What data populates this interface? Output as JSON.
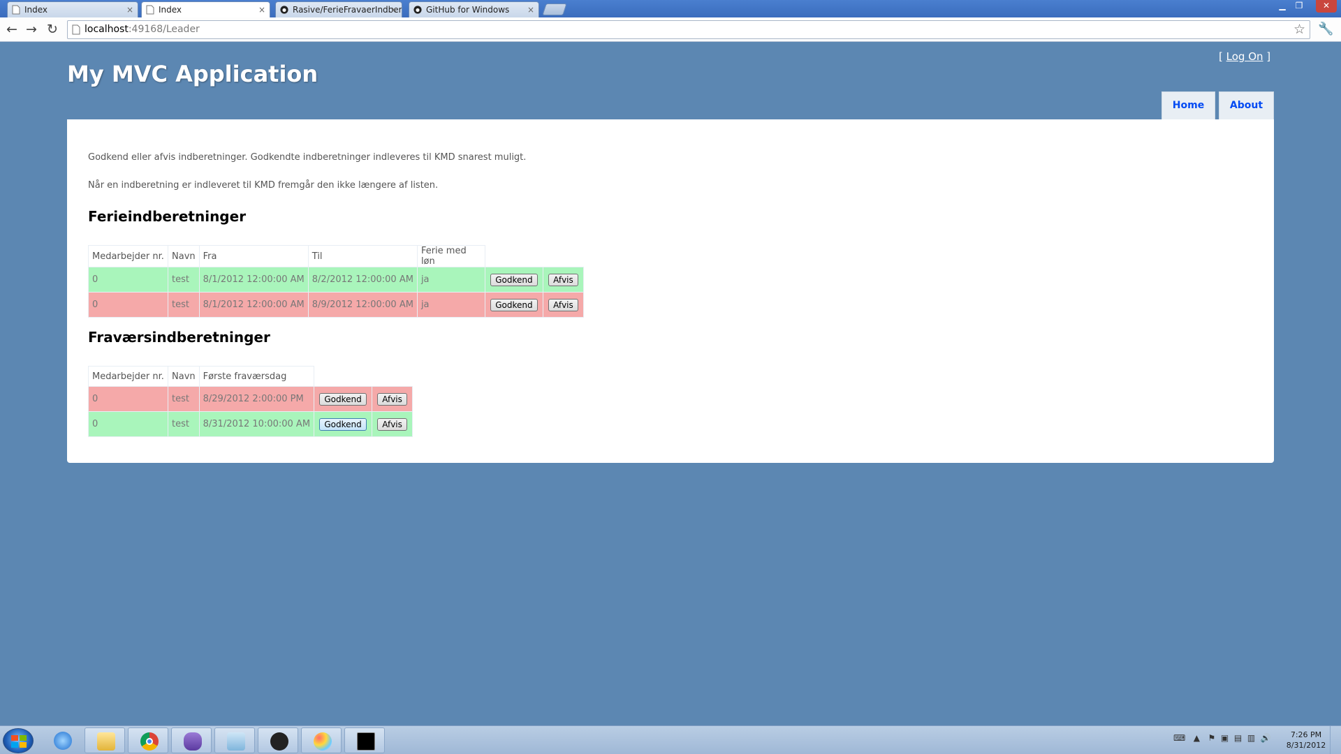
{
  "browser": {
    "tabs": [
      {
        "label": "Index",
        "active": false
      },
      {
        "label": "Index",
        "active": true
      },
      {
        "label": "Rasive/FerieFravaerIndbere",
        "active": false
      },
      {
        "label": "GitHub for Windows",
        "active": false
      }
    ],
    "url_host": "localhost",
    "url_rest": ":49168/Leader"
  },
  "header": {
    "title": "My MVC Application",
    "logon_prefix": "[",
    "logon_link": "Log On",
    "logon_suffix": "]",
    "menu": [
      "Home",
      "About"
    ]
  },
  "content": {
    "intro_1": "Godkend eller afvis indberetninger. Godkendte indberetninger indleveres til KMD snarest muligt.",
    "intro_2": "Når en indberetning er indleveret til KMD fremgår den ikke længere af listen.",
    "vacation": {
      "heading": "Ferieindberetninger",
      "columns": [
        "Medarbejder nr.",
        "Navn",
        "Fra",
        "Til",
        "Ferie med løn"
      ],
      "rows": [
        {
          "nr": "0",
          "navn": "test",
          "fra": "8/1/2012 12:00:00 AM",
          "til": "8/2/2012 12:00:00 AM",
          "loen": "ja",
          "status": "green"
        },
        {
          "nr": "0",
          "navn": "test",
          "fra": "8/1/2012 12:00:00 AM",
          "til": "8/9/2012 12:00:00 AM",
          "loen": "ja",
          "status": "red"
        }
      ]
    },
    "absence": {
      "heading": "Fraværsindberetninger",
      "columns": [
        "Medarbejder nr.",
        "Navn",
        "Første fraværsdag"
      ],
      "rows": [
        {
          "nr": "0",
          "navn": "test",
          "dag": "8/29/2012 2:00:00 PM",
          "status": "red"
        },
        {
          "nr": "0",
          "navn": "test",
          "dag": "8/31/2012 10:00:00 AM",
          "status": "green"
        }
      ]
    },
    "approve_label": "Godkend",
    "reject_label": "Afvis"
  },
  "colors": {
    "page_bg": "#5c87b2",
    "row_green": "#a9f5bb",
    "row_red": "#f5a9a9",
    "menu_link": "#034af3"
  },
  "taskbar": {
    "apps": [
      "internet-explorer",
      "file-explorer",
      "chrome",
      "visual-studio",
      "notepad",
      "github",
      "paint",
      "command-prompt"
    ],
    "time": "7:26 PM",
    "date": "8/31/2012"
  }
}
